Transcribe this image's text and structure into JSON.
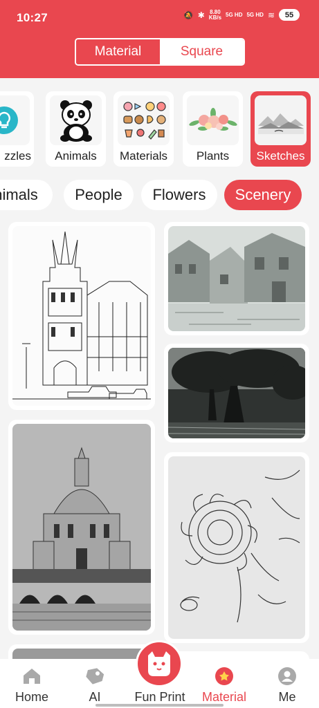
{
  "status_bar": {
    "time": "10:27",
    "net_speed": "8.80",
    "net_unit": "KB/s",
    "sig1": "5G HD",
    "sig2": "5G HD",
    "battery": "55"
  },
  "segment": {
    "options": [
      "Material",
      "Square"
    ],
    "selected": "Material"
  },
  "categories": [
    {
      "label": "zzles",
      "icon": "lightbulb-icon"
    },
    {
      "label": "Animals",
      "icon": "panda-icon"
    },
    {
      "label": "Materials",
      "icon": "sweets-icon"
    },
    {
      "label": "Plants",
      "icon": "flowers-icon"
    },
    {
      "label": "Sketches",
      "icon": "landscape-sketch-icon",
      "selected": true
    }
  ],
  "chips": [
    {
      "label": "nimals"
    },
    {
      "label": "People"
    },
    {
      "label": "Flowers"
    },
    {
      "label": "Scenery",
      "selected": true
    }
  ],
  "gallery": [
    {
      "subject": "gothic-tower-sketch"
    },
    {
      "subject": "village-sketch"
    },
    {
      "subject": "tree-sketch"
    },
    {
      "subject": "domed-building-sketch"
    },
    {
      "subject": "flower-sketch"
    }
  ],
  "tab_bar": {
    "items": [
      {
        "label": "Home",
        "icon": "home-icon"
      },
      {
        "label": "AI",
        "icon": "ai-tag-icon"
      },
      {
        "label": "Fun Print",
        "icon": "cat-printer-icon"
      },
      {
        "label": "Material",
        "icon": "material-flower-icon",
        "selected": true
      },
      {
        "label": "Me",
        "icon": "user-icon"
      }
    ]
  },
  "colors": {
    "accent": "#e9474f",
    "background": "#f4f4f4"
  }
}
